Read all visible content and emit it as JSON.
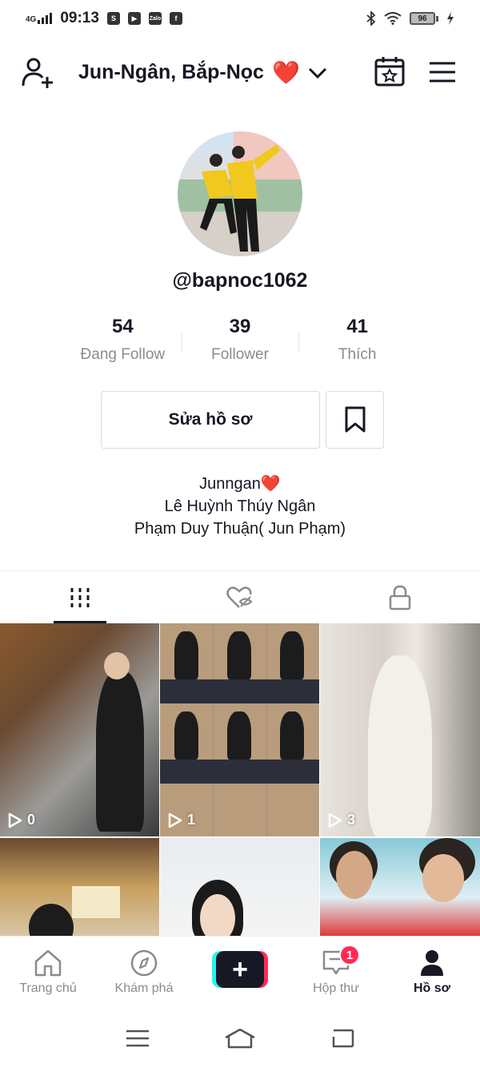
{
  "status_bar": {
    "network": "4G",
    "time": "09:13",
    "battery": "96"
  },
  "header": {
    "title": "Jun-Ngân, Bắp-Nọc",
    "title_emoji": "❤️"
  },
  "profile": {
    "handle": "@bapnoc1062",
    "stats": [
      {
        "value": "54",
        "label": "Đang Follow"
      },
      {
        "value": "39",
        "label": "Follower"
      },
      {
        "value": "41",
        "label": "Thích"
      }
    ],
    "edit_button": "Sửa hồ sơ",
    "bio_lines": [
      "Junngan",
      "Lê Huỳnh Thúy Ngân",
      "Phạm Duy Thuận( Jun Phạm)"
    ],
    "bio_emoji": "❤️"
  },
  "tabs": [
    {
      "icon": "grid-icon",
      "active": true
    },
    {
      "icon": "liked-hidden-icon",
      "active": false
    },
    {
      "icon": "lock-icon",
      "active": false
    }
  ],
  "videos": [
    {
      "views": "0"
    },
    {
      "views": "1"
    },
    {
      "views": "3"
    },
    {
      "views": ""
    },
    {
      "views": ""
    },
    {
      "views": ""
    }
  ],
  "bottom_nav": {
    "home": "Trang chủ",
    "discover": "Khám phá",
    "inbox": "Hộp thư",
    "inbox_badge": "1",
    "profile": "Hồ sơ"
  },
  "colors": {
    "accent_red": "#fe2c55",
    "accent_cyan": "#25f4ee",
    "heart": "#d3202b",
    "text": "#161823",
    "muted": "#8a8b91"
  }
}
